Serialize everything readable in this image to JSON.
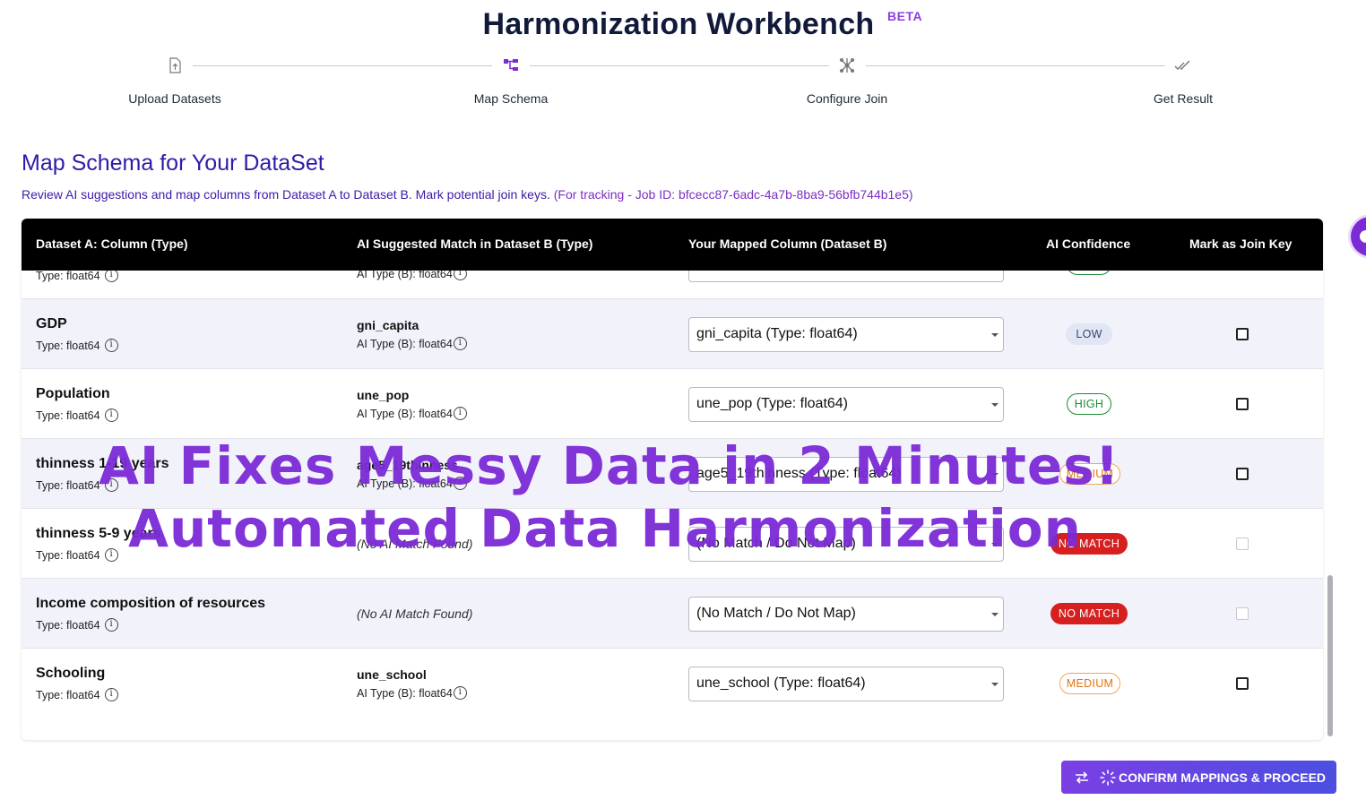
{
  "header": {
    "title": "Harmonization Workbench",
    "badge": "BETA"
  },
  "stepper": {
    "steps": [
      {
        "label": "Upload Datasets",
        "icon": "upload-file-icon"
      },
      {
        "label": "Map Schema",
        "icon": "schema-icon"
      },
      {
        "label": "Configure Join",
        "icon": "join-icon"
      },
      {
        "label": "Get Result",
        "icon": "double-check-icon"
      }
    ],
    "active_step": "Map Schema"
  },
  "section": {
    "title": "Map Schema for Your DataSet",
    "description": "Review AI suggestions and map columns from Dataset A to Dataset B. Mark potential join keys. ",
    "job_text": "(For tracking - Job ID: bfcecc87-6adc-4a7b-8ba9-56bfb744b1e5)"
  },
  "table": {
    "headers": {
      "col_a": "Dataset A: Column (Type)",
      "col_b": "AI Suggested Match in Dataset B (Type)",
      "mapped": "Your Mapped Column (Dataset B)",
      "confidence": "AI Confidence",
      "join_key": "Mark as Join Key"
    },
    "partial_row": {
      "type_a": "Type: float64",
      "type_b": "AI Type (B): float64"
    },
    "rows": [
      {
        "name": "GDP",
        "type": "Type: float64",
        "b_name": "gni_capita",
        "b_type": "AI Type (B): float64",
        "mapped": "gni_capita (Type: float64)",
        "confidence": "LOW"
      },
      {
        "name": "Population",
        "type": "Type: float64",
        "b_name": "une_pop",
        "b_type": "AI Type (B): float64",
        "mapped": "une_pop (Type: float64)",
        "confidence": "HIGH"
      },
      {
        "name": "thinness 1-19 years",
        "type": "Type: float64",
        "b_name": "age5_19thinness",
        "b_type": "AI Type (B): float64",
        "mapped": "age5_19thinness (Type: float64)",
        "confidence": "MEDIUM"
      },
      {
        "name": "thinness 5-9 years",
        "type": "Type: float64",
        "b_nomatch": "(No AI Match Found)",
        "mapped": "(No Match / Do Not Map)",
        "confidence": "NO MATCH"
      },
      {
        "name": "Income composition of resources",
        "type": "Type: float64",
        "b_nomatch": "(No AI Match Found)",
        "mapped": "(No Match / Do Not Map)",
        "confidence": "NO MATCH"
      },
      {
        "name": "Schooling",
        "type": "Type: float64",
        "b_name": "une_school",
        "b_type": "AI Type (B): float64",
        "mapped": "une_school (Type: float64)",
        "confidence": "MEDIUM"
      }
    ]
  },
  "actions": {
    "confirm": "CONFIRM MAPPINGS & PROCEED"
  },
  "overlay": {
    "line1": "AI Fixes Messy Data in 2 Minutes!",
    "line2": "Automated Data Harmonization"
  },
  "colors": {
    "accent": "#7b2ad6",
    "title": "#2d1ca8",
    "header_bg": "#000000",
    "no_match": "#d62020",
    "high": "#1d8a35",
    "medium": "#e07412"
  }
}
